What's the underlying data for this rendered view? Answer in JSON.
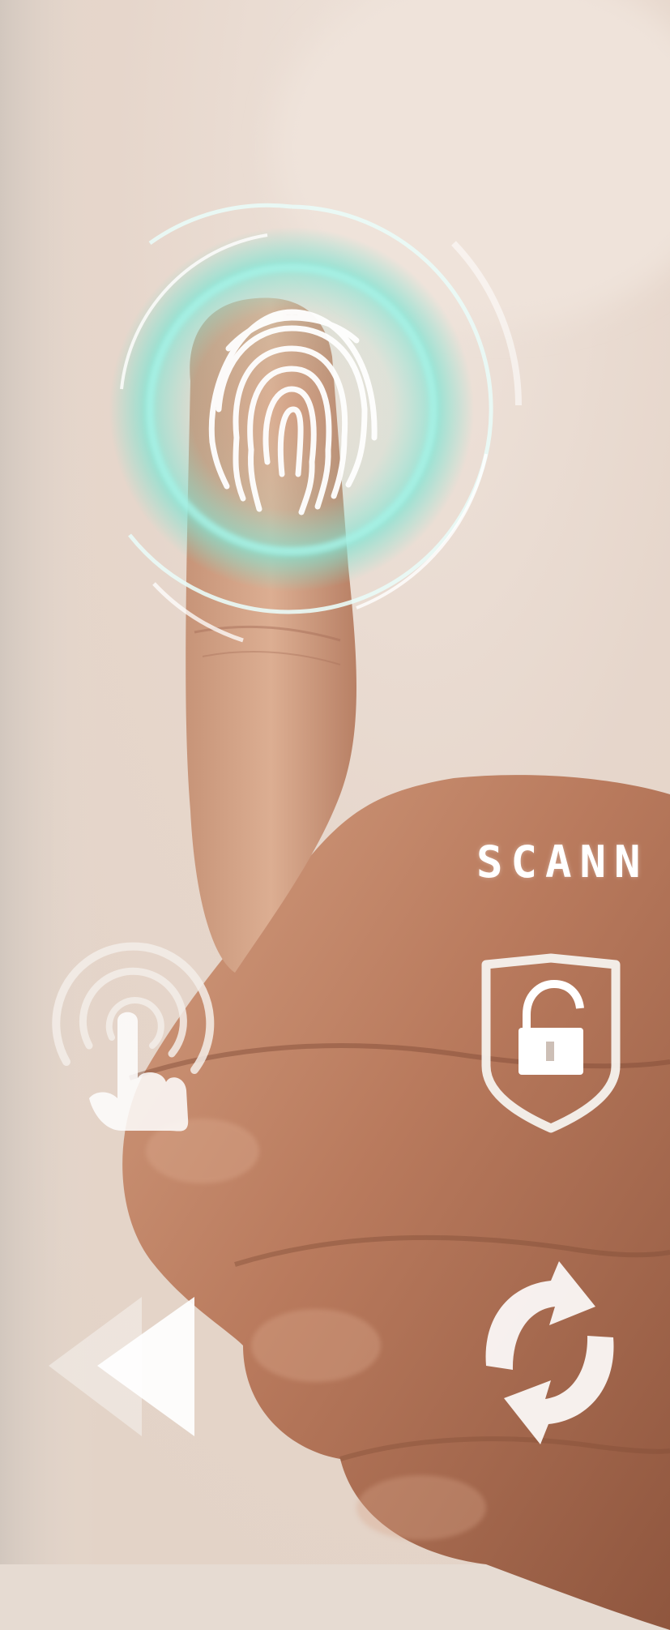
{
  "scan_text": "SCANN",
  "icons": {
    "fingerprint": "fingerprint-icon",
    "touch": "touch-icon",
    "unlock_shield": "shield-unlock-icon",
    "rewind": "rewind-icon",
    "refresh": "refresh-icon"
  },
  "colors": {
    "background": "#e9dcd3",
    "skin": "#b87a5e",
    "glow": "#7fe3d2",
    "overlay": "#ffffff"
  }
}
